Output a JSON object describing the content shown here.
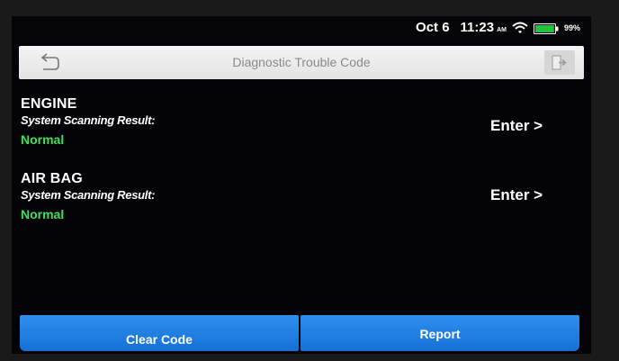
{
  "status_bar": {
    "date": "Oct 6",
    "time": "11:23",
    "ampm": "AM",
    "battery_percent": "99%",
    "battery_level": 0.99,
    "icons": [
      "wifi-icon",
      "battery-icon"
    ]
  },
  "header": {
    "title": "Diagnostic Trouble Code",
    "back_icon": "back-icon",
    "exit_icon": "exit-icon"
  },
  "systems": [
    {
      "name": "ENGINE",
      "result_label": "System Scanning Result:",
      "status": "Normal",
      "enter_label": "Enter >"
    },
    {
      "name": "AIR BAG",
      "result_label": "System Scanning Result:",
      "status": "Normal",
      "enter_label": "Enter >"
    }
  ],
  "footer": {
    "clear_code_label": "Clear Code",
    "report_label": "Report"
  },
  "colors": {
    "status_normal": "#3fe05a",
    "button_blue": "#1f7fe6",
    "screen_bg": "#030308",
    "battery_green": "#22c23a"
  }
}
